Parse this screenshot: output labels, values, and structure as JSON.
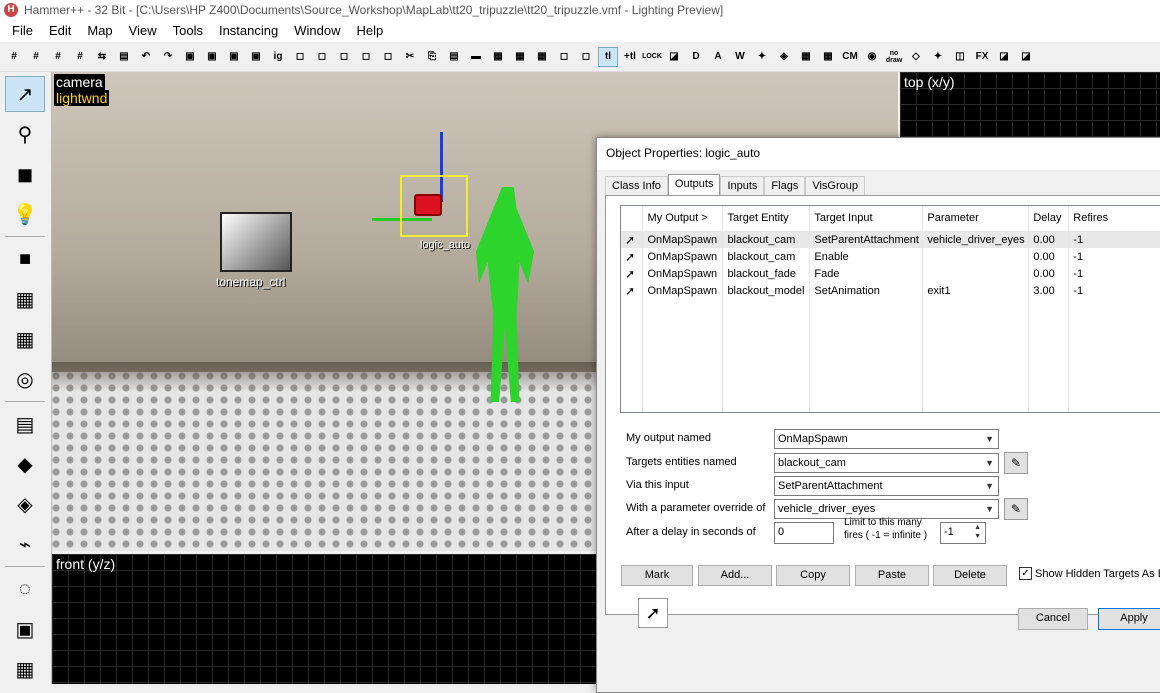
{
  "window": {
    "title": "Hammer++ - 32 Bit - [C:\\Users\\HP Z400\\Documents\\Source_Workshop\\MapLab\\tt20_tripuzzle\\tt20_tripuzzle.vmf - Lighting Preview]"
  },
  "menu": [
    "File",
    "Edit",
    "Map",
    "View",
    "Tools",
    "Instancing",
    "Window",
    "Help"
  ],
  "toolbar": [
    "#",
    "#",
    "#",
    "#",
    "⇆",
    "▤",
    "↶",
    "↷",
    "▣",
    "▣",
    "▣",
    "▣",
    "ig",
    "◻",
    "◻",
    "◻",
    "◻",
    "◻",
    "✂",
    "⎘",
    "▤",
    "▬",
    "▦",
    "▦",
    "▦",
    "◻",
    "◻",
    "tl",
    "+tl",
    "LOCK",
    "◪",
    "D",
    "A",
    "W",
    "✦",
    "◈",
    "▦",
    "▦",
    "CM",
    "◉",
    "no draw",
    "◇",
    "✦",
    "◫",
    "FX",
    "◪",
    "◪"
  ],
  "lefttools": [
    "select",
    "magnify",
    "camera",
    "entity",
    "block",
    "texture",
    "apply-texture",
    "decal",
    "overlay",
    "clip",
    "vertex",
    "path",
    "cordon",
    "cube",
    "crate"
  ],
  "viewports": {
    "camera": {
      "label": "camera",
      "sublabel": "lightwnd"
    },
    "top": {
      "label": "top (x/y)"
    },
    "front": {
      "label": "front (y/z)"
    }
  },
  "scene": {
    "tonemap_label": "tonemap_ctrl",
    "logic_label": "logic_auto"
  },
  "dialog": {
    "title": "Object Properties: logic_auto",
    "tabs": [
      "Class Info",
      "Outputs",
      "Inputs",
      "Flags",
      "VisGroup"
    ],
    "active_tab": "Outputs",
    "columns": [
      "My Output  >",
      "Target Entity",
      "Target Input",
      "Parameter",
      "Delay",
      "Refires"
    ],
    "rows": [
      [
        "OnMapSpawn",
        "blackout_cam",
        "SetParentAttachment",
        "vehicle_driver_eyes",
        "0.00",
        "-1"
      ],
      [
        "OnMapSpawn",
        "blackout_cam",
        "Enable",
        "",
        "0.00",
        "-1"
      ],
      [
        "OnMapSpawn",
        "blackout_fade",
        "Fade",
        "",
        "0.00",
        "-1"
      ],
      [
        "OnMapSpawn",
        "blackout_model",
        "SetAnimation",
        "exit1",
        "3.00",
        "-1"
      ]
    ],
    "form": {
      "output_label": "My output named",
      "output_value": "OnMapSpawn",
      "targets_label": "Targets entities named",
      "targets_value": "blackout_cam",
      "input_label": "Via this input",
      "input_value": "SetParentAttachment",
      "param_label": "With a parameter override of",
      "param_value": "vehicle_driver_eyes",
      "delay_label": "After a delay in seconds of",
      "delay_value": "0",
      "limit_label": "Limit to this many fires ( -1 = infinite )",
      "limit_value": "-1"
    },
    "buttons": {
      "mark": "Mark",
      "add": "Add...",
      "copy": "Copy",
      "paste": "Paste",
      "delete": "Delete",
      "cancel": "Cancel",
      "apply": "Apply"
    },
    "show_hidden": "Show Hidden Targets As B"
  }
}
